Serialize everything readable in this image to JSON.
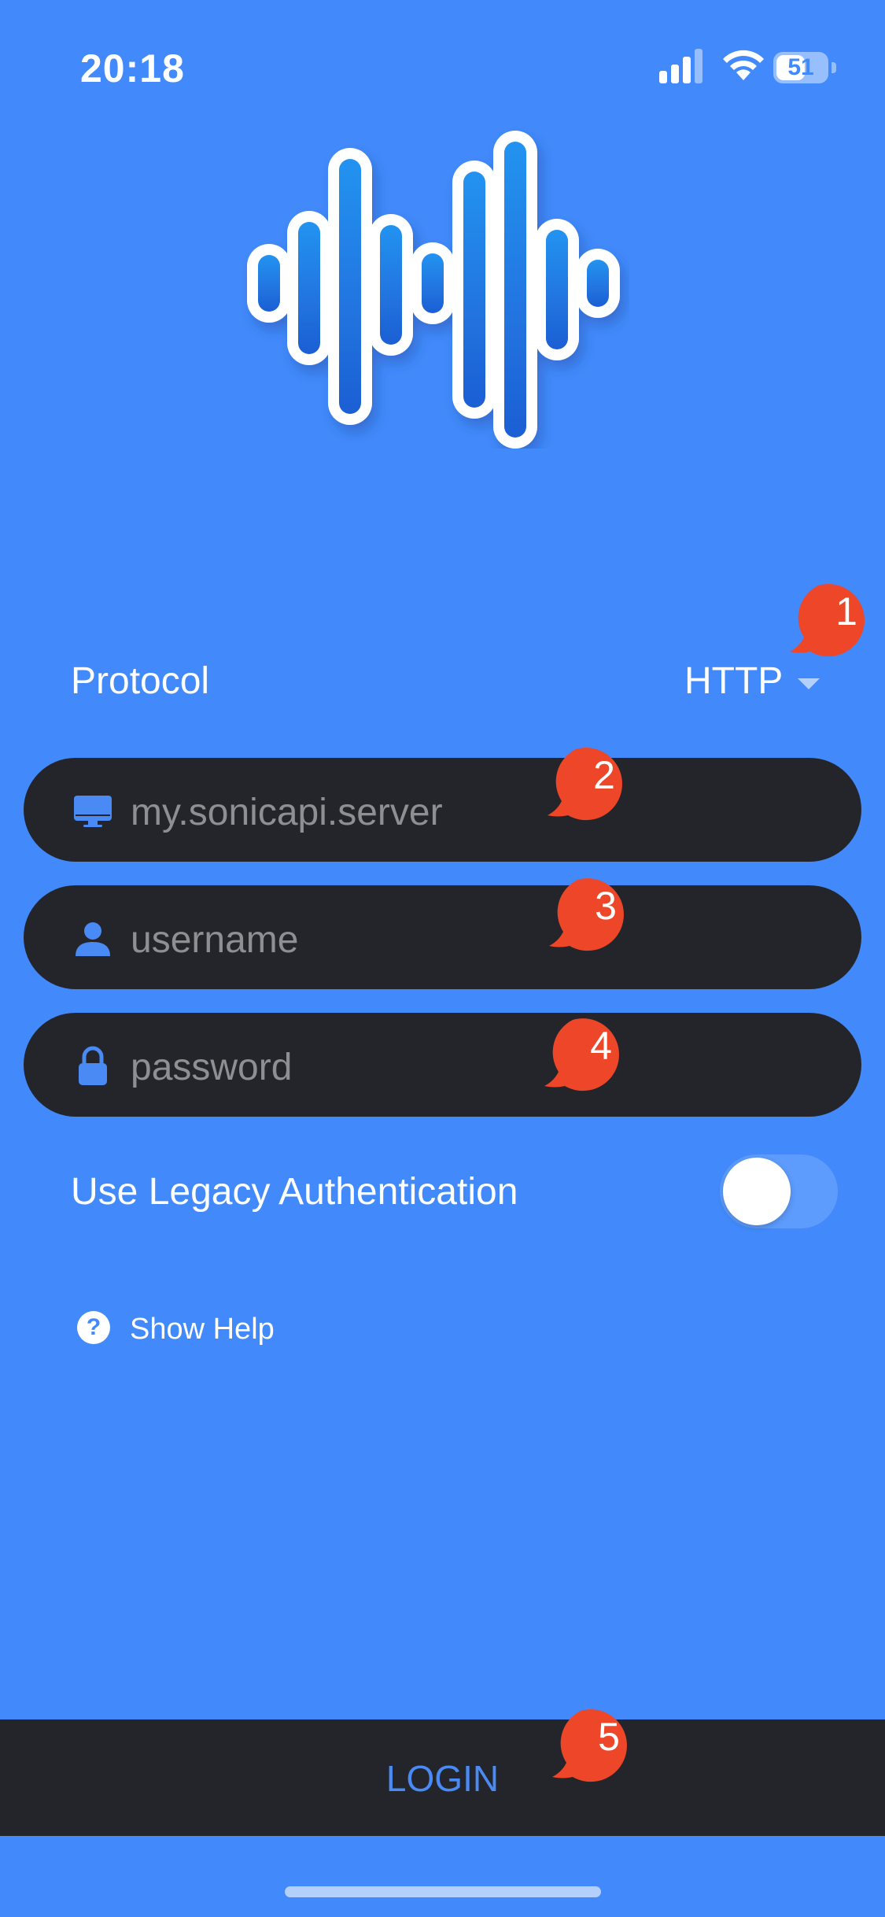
{
  "status_bar": {
    "time": "20:18",
    "battery": "51"
  },
  "protocol": {
    "label": "Protocol",
    "value": "HTTP"
  },
  "fields": {
    "server": {
      "placeholder": "my.sonicapi.server"
    },
    "username": {
      "placeholder": "username"
    },
    "password": {
      "placeholder": "password"
    }
  },
  "legacy_auth": {
    "label": "Use Legacy Authentication",
    "enabled": false
  },
  "help": {
    "label": "Show Help",
    "icon": "?"
  },
  "login": {
    "label": "LOGIN"
  },
  "callouts": [
    "1",
    "2",
    "3",
    "4",
    "5"
  ],
  "colors": {
    "background": "#428AFB",
    "field": "#24252A",
    "callout": "#EE4628",
    "login_text": "#4A8AF4"
  }
}
